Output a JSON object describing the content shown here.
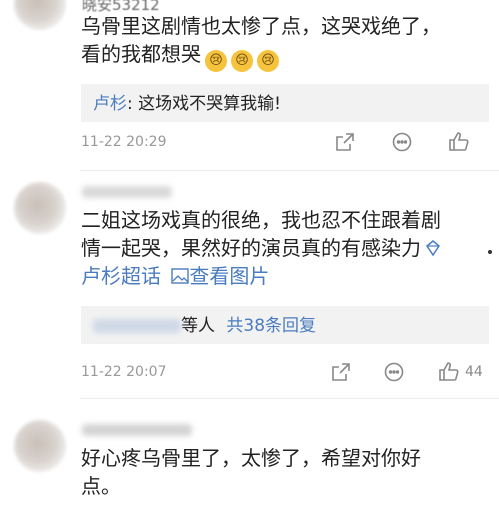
{
  "comments": [
    {
      "username": "晓安53212",
      "text_lines": [
        "乌骨里这剧情也太惨了点，这哭戏绝了，",
        "看的我都想哭"
      ],
      "emoji_count": 3,
      "reply": {
        "name": "卢杉",
        "text": ": 这场戏不哭算我输!"
      },
      "time": "11-22 20:29",
      "likes": ""
    },
    {
      "username": "",
      "text_lines": [
        "二姐这场戏真的很绝，我也忍不住跟着剧",
        "情一起哭，果然好的演员真的有感染力"
      ],
      "links": {
        "super": "卢杉超话",
        "pics": "查看图片"
      },
      "reply_summary": {
        "suffix": "等人",
        "count_text": "共38条回复"
      },
      "time": "11-22 20:07",
      "likes": "44"
    },
    {
      "username": "",
      "text_lines": [
        "好心疼乌骨里了，太惨了，希望对你好",
        "点。"
      ]
    }
  ],
  "icons": {
    "share": "share-icon",
    "comment": "comment-icon",
    "like": "thumbs-up-icon",
    "emoji": "crying-face-emoji",
    "picture": "picture-icon",
    "badge": "super-topic-badge-icon"
  },
  "colors": {
    "link": "#4a7cbf",
    "meta": "#999999",
    "reply_bg": "#f2f2f2"
  }
}
